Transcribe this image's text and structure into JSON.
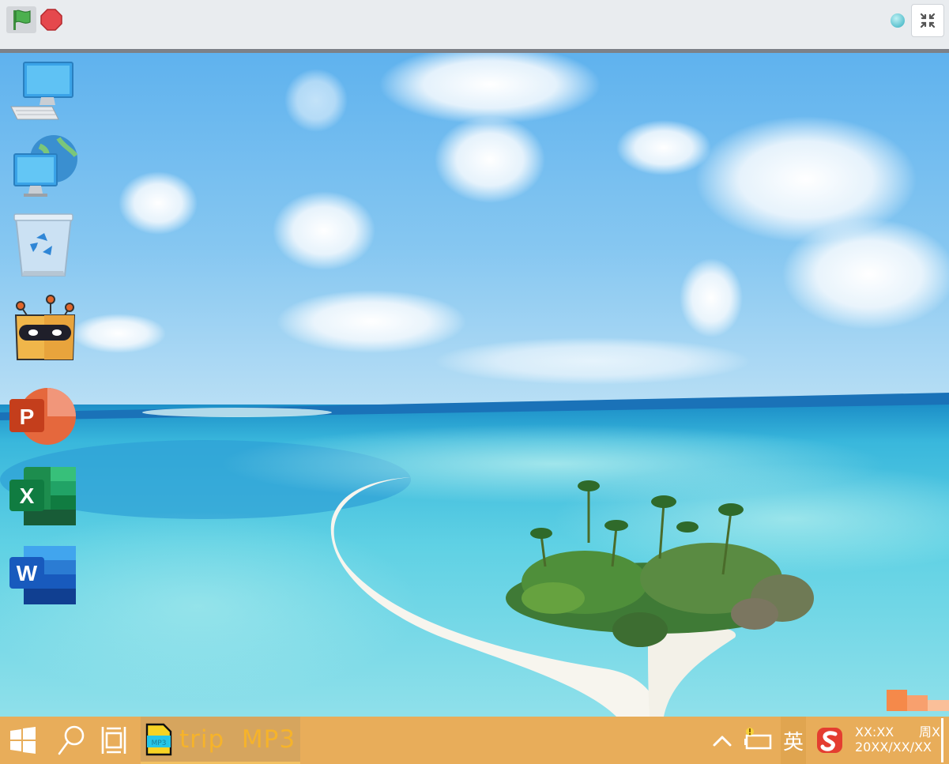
{
  "topbar": {
    "flag_icon": "green-flag-icon",
    "stop_icon": "stop-sign-icon",
    "status_indicator": "status-dot",
    "shrink_icon": "shrink-screen-icon",
    "colors": {
      "flag": "#4cb04f",
      "stop": "#e5484d",
      "bar": "#e9ecef"
    }
  },
  "desktop": {
    "wallpaper": "tropical-island-beach",
    "icons": [
      {
        "name": "this-pc-icon",
        "icon": "computer-icon"
      },
      {
        "name": "network-icon",
        "icon": "globe-computer-icon"
      },
      {
        "name": "recycle-bin-icon",
        "icon": "recycle-bin-icon"
      },
      {
        "name": "robot-app-icon",
        "icon": "robot-icon"
      },
      {
        "name": "powerpoint-icon",
        "icon": "powerpoint-icon",
        "letter": "P"
      },
      {
        "name": "excel-icon",
        "icon": "excel-icon",
        "letter": "X"
      },
      {
        "name": "word-icon",
        "icon": "word-icon",
        "letter": "W"
      }
    ]
  },
  "taskbar": {
    "color": "#e8ad5a",
    "start_icon": "windows-start-icon",
    "search_icon": "search-icon",
    "task_view_icon": "task-view-icon",
    "open_app": {
      "badge": "MP3",
      "label": "trip  MP3"
    },
    "tray": {
      "chevron_icon": "chevron-up-icon",
      "battery_icon": "battery-warning-icon",
      "ime_label": "英",
      "sogou_icon": "sogou-input-icon",
      "time": "XX:XX",
      "weekday": "周X",
      "date": "20XX/XX/XX"
    }
  }
}
